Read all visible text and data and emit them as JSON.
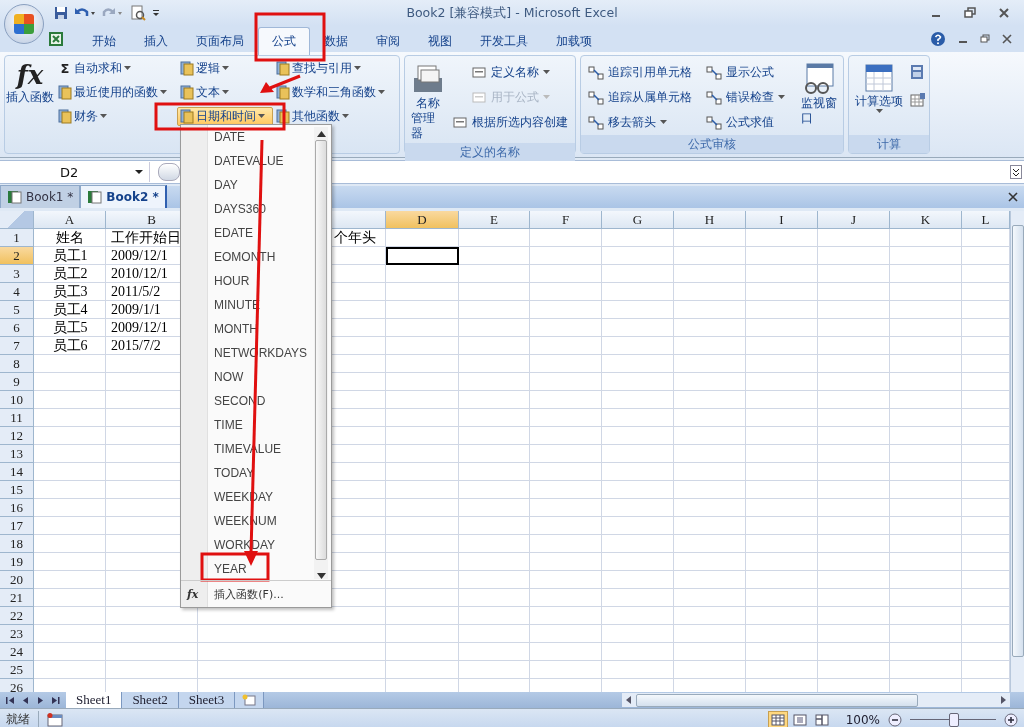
{
  "window": {
    "title": "Book2  [兼容模式] - Microsoft Excel"
  },
  "ribbon_tabs": [
    {
      "label": "开始",
      "selected": false
    },
    {
      "label": "插入",
      "selected": false
    },
    {
      "label": "页面布局",
      "selected": false
    },
    {
      "label": "公式",
      "selected": true
    },
    {
      "label": "数据",
      "selected": false
    },
    {
      "label": "审阅",
      "selected": false
    },
    {
      "label": "视图",
      "selected": false
    },
    {
      "label": "开发工具",
      "selected": false
    },
    {
      "label": "加载项",
      "selected": false
    }
  ],
  "function_library": {
    "insert_symbol": "fx",
    "insert_label": "插入函数",
    "items": [
      {
        "label": "自动求和",
        "symbol": "Σ",
        "open": false
      },
      {
        "label": "最近使用的函数",
        "open": false
      },
      {
        "label": "财务",
        "open": false
      },
      {
        "label": "逻辑",
        "open": false
      },
      {
        "label": "文本",
        "open": false
      },
      {
        "label": "日期和时间",
        "open": true
      },
      {
        "label": "查找与引用",
        "open": false
      },
      {
        "label": "数学和三角函数",
        "open": false
      },
      {
        "label": "其他函数",
        "open": false
      }
    ]
  },
  "defined_names": {
    "title": "定义的名称",
    "manager_lines": [
      "名称",
      "管理器"
    ],
    "items": [
      {
        "label": "定义名称",
        "dropdown": true,
        "disabled": false
      },
      {
        "label": "用于公式",
        "dropdown": true,
        "disabled": true
      },
      {
        "label": "根据所选内容创建",
        "dropdown": false,
        "disabled": false
      }
    ]
  },
  "formula_auditing": {
    "title": "公式审核",
    "watch_window": "监视窗口",
    "items": [
      {
        "label": "追踪引用单元格",
        "dropdown": false
      },
      {
        "label": "追踪从属单元格",
        "dropdown": false
      },
      {
        "label": "移去箭头",
        "dropdown": true
      },
      {
        "label": "显示公式",
        "dropdown": false
      },
      {
        "label": "错误检查",
        "dropdown": true
      },
      {
        "label": "公式求值",
        "dropdown": false
      }
    ]
  },
  "calculation": {
    "title": "计算",
    "options": "计算选项"
  },
  "formula_bar": {
    "name_box": "D2"
  },
  "workbooks": [
    {
      "label": "Book1 *",
      "selected": false
    },
    {
      "label": "Book2 *",
      "selected": true
    }
  ],
  "sheet": {
    "columns": [
      {
        "label": "A",
        "selected": false
      },
      {
        "label": "B",
        "selected": false
      },
      {
        "selected": false
      },
      {
        "label": "D",
        "selected": true
      },
      {
        "label": "E",
        "selected": false
      },
      {
        "label": "F",
        "selected": false
      },
      {
        "label": "G",
        "selected": false
      },
      {
        "label": "H",
        "selected": false
      },
      {
        "label": "I",
        "selected": false
      },
      {
        "label": "J",
        "selected": false
      },
      {
        "label": "K",
        "selected": false
      },
      {
        "label": "L",
        "selected": false
      }
    ],
    "rows": [
      {
        "number": "1",
        "selected": false,
        "a": "姓名",
        "b": "工作开始日",
        "c": "个年头"
      },
      {
        "number": "2",
        "selected": true,
        "a": "员工1",
        "b": "2009/12/1"
      },
      {
        "number": "3",
        "selected": false,
        "a": "员工2",
        "b": "2010/12/1"
      },
      {
        "number": "4",
        "selected": false,
        "a": "员工3",
        "b": "2011/5/2"
      },
      {
        "number": "5",
        "selected": false,
        "a": "员工4",
        "b": "2009/1/1"
      },
      {
        "number": "6",
        "selected": false,
        "a": "员工5",
        "b": "2009/12/1"
      },
      {
        "number": "7",
        "selected": false,
        "a": "员工6",
        "b": "2015/7/2"
      },
      {
        "number": "8",
        "selected": false
      },
      {
        "number": "9",
        "selected": false
      },
      {
        "number": "10",
        "selected": false
      },
      {
        "number": "11",
        "selected": false
      },
      {
        "number": "12",
        "selected": false
      },
      {
        "number": "13",
        "selected": false
      },
      {
        "number": "14",
        "selected": false
      },
      {
        "number": "15",
        "selected": false
      },
      {
        "number": "16",
        "selected": false
      },
      {
        "number": "17",
        "selected": false
      },
      {
        "number": "18",
        "selected": false
      },
      {
        "number": "19",
        "selected": false
      },
      {
        "number": "20",
        "selected": false
      },
      {
        "number": "21",
        "selected": false
      },
      {
        "number": "22",
        "selected": false
      },
      {
        "number": "23",
        "selected": false
      },
      {
        "number": "24",
        "selected": false
      },
      {
        "number": "25",
        "selected": false
      },
      {
        "number": "26",
        "selected": false
      }
    ]
  },
  "function_menu": {
    "items": [
      "DATE",
      "DATEVALUE",
      "DAY",
      "DAYS360",
      "EDATE",
      "EOMONTH",
      "HOUR",
      "MINUTE",
      "MONTH",
      "NETWORKDAYS",
      "NOW",
      "SECOND",
      "TIME",
      "TIMEVALUE",
      "TODAY",
      "WEEKDAY",
      "WEEKNUM",
      "WORKDAY",
      "YEAR"
    ],
    "footer_symbol": "fx",
    "footer": "插入函数(F)..."
  },
  "sheet_tabs": [
    {
      "label": "Sheet1",
      "selected": true
    },
    {
      "label": "Sheet2",
      "selected": false
    },
    {
      "label": "Sheet3",
      "selected": false
    }
  ],
  "status_bar": {
    "status": "就绪",
    "views": [
      {
        "selected": true
      },
      {
        "selected": false
      },
      {
        "selected": false
      }
    ],
    "zoom": "100%",
    "zoom_slider": {
      "level": 0.5
    }
  }
}
